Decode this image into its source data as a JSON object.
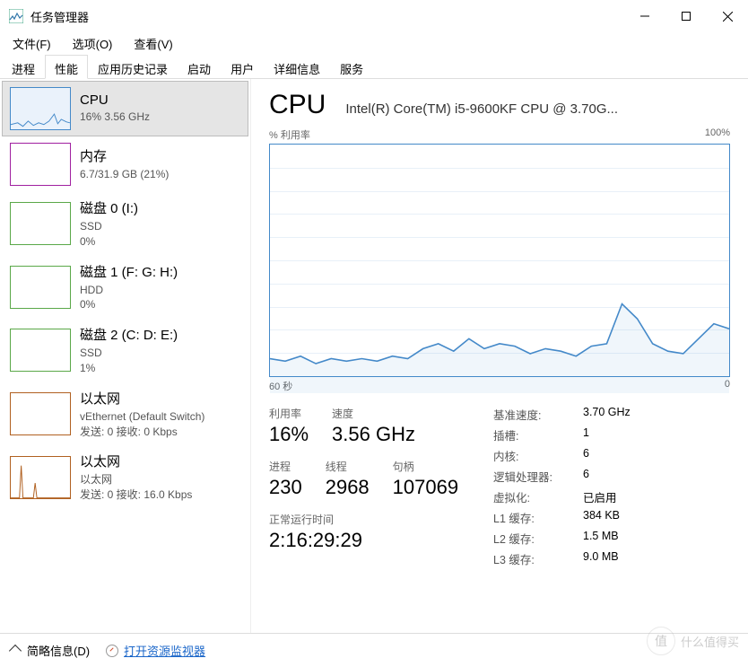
{
  "window": {
    "title": "任务管理器"
  },
  "menu": {
    "file": "文件(F)",
    "options": "选项(O)",
    "view": "查看(V)"
  },
  "tabs": {
    "processes": "进程",
    "performance": "性能",
    "app_history": "应用历史记录",
    "startup": "启动",
    "users": "用户",
    "details": "详细信息",
    "services": "服务"
  },
  "sidebar": [
    {
      "name": "CPU",
      "sub": "16% 3.56 GHz",
      "color": "#4489c9",
      "fill": "#eaf2fb"
    },
    {
      "name": "内存",
      "sub": "6.7/31.9 GB (21%)",
      "color": "#a020a0",
      "fill": "#fff"
    },
    {
      "name": "磁盘 0 (I:)",
      "sub": "SSD\n0%",
      "color": "#5aa848",
      "fill": "#fff"
    },
    {
      "name": "磁盘 1 (F: G: H:)",
      "sub": "HDD\n0%",
      "color": "#5aa848",
      "fill": "#fff"
    },
    {
      "name": "磁盘 2 (C: D: E:)",
      "sub": "SSD\n1%",
      "color": "#5aa848",
      "fill": "#fff"
    },
    {
      "name": "以太网",
      "sub": "vEthernet (Default Switch)\n发送: 0 接收: 0 Kbps",
      "color": "#b06020",
      "fill": "#fff"
    },
    {
      "name": "以太网",
      "sub": "以太网\n发送: 0 接收: 16.0 Kbps",
      "color": "#b06020",
      "fill": "#fff"
    }
  ],
  "main": {
    "title": "CPU",
    "subtitle": "Intel(R) Core(TM) i5-9600KF CPU @ 3.70G...",
    "chart_top_left": "% 利用率",
    "chart_top_right": "100%",
    "chart_bottom_left": "60 秒",
    "chart_bottom_right": "0"
  },
  "stats": {
    "utilization_label": "利用率",
    "utilization": "16%",
    "speed_label": "速度",
    "speed": "3.56 GHz",
    "processes_label": "进程",
    "processes": "230",
    "threads_label": "线程",
    "threads": "2968",
    "handles_label": "句柄",
    "handles": "107069",
    "uptime_label": "正常运行时间",
    "uptime": "2:16:29:29"
  },
  "info": {
    "base_speed_k": "基准速度:",
    "base_speed_v": "3.70 GHz",
    "sockets_k": "插槽:",
    "sockets_v": "1",
    "cores_k": "内核:",
    "cores_v": "6",
    "logical_k": "逻辑处理器:",
    "logical_v": "6",
    "virt_k": "虚拟化:",
    "virt_v": "已启用",
    "l1_k": "L1 缓存:",
    "l1_v": "384 KB",
    "l2_k": "L2 缓存:",
    "l2_v": "1.5 MB",
    "l3_k": "L3 缓存:",
    "l3_v": "9.0 MB"
  },
  "footer": {
    "brief": "简略信息(D)",
    "resmon": "打开资源监视器"
  },
  "chart_data": {
    "type": "line",
    "title": "% 利用率",
    "xlabel": "秒",
    "ylabel": "%",
    "xlim": [
      60,
      0
    ],
    "ylim": [
      0,
      100
    ],
    "x": [
      60,
      58,
      56,
      54,
      52,
      50,
      48,
      46,
      44,
      42,
      40,
      38,
      36,
      34,
      32,
      30,
      28,
      26,
      24,
      22,
      20,
      18,
      16,
      14,
      12,
      10,
      8,
      6,
      4,
      2,
      0
    ],
    "series": [
      {
        "name": "CPU 利用率",
        "values": [
          14,
          13,
          15,
          12,
          14,
          13,
          14,
          13,
          15,
          14,
          18,
          20,
          17,
          22,
          18,
          20,
          19,
          16,
          18,
          17,
          15,
          19,
          20,
          36,
          30,
          20,
          17,
          16,
          22,
          28,
          26
        ]
      }
    ]
  },
  "watermark": {
    "char": "值",
    "text": "什么值得买"
  }
}
